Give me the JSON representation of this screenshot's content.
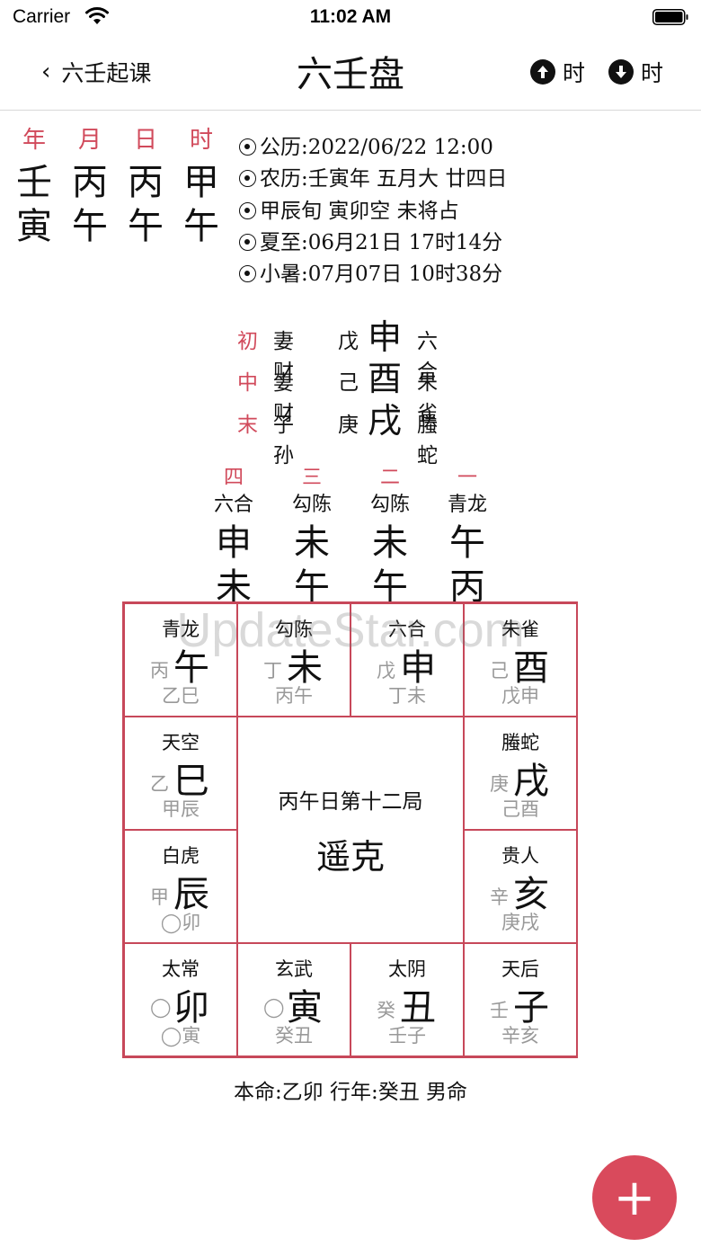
{
  "status": {
    "carrier": "Carrier",
    "time": "11:02 AM"
  },
  "nav": {
    "back_label": "六壬起课",
    "title": "六壬盘",
    "prev_hour": "时",
    "next_hour": "时"
  },
  "pillars": {
    "labels": [
      "年",
      "月",
      "日",
      "时"
    ],
    "stems": [
      "壬",
      "丙",
      "丙",
      "甲"
    ],
    "branches": [
      "寅",
      "午",
      "午",
      "午"
    ]
  },
  "info": [
    "公历:2022/06/22 12:00",
    "农历:壬寅年 五月大 廿四日",
    "甲辰旬 寅卯空 未将占",
    "夏至:06月21日 17时14分",
    "小暑:07月07日 10时38分"
  ],
  "transmissions": [
    {
      "label": "初",
      "relation": "妻财",
      "stem": "戊",
      "branch": "申",
      "god": "六合"
    },
    {
      "label": "中",
      "relation": "妻财",
      "stem": "己",
      "branch": "酉",
      "god": "朱雀"
    },
    {
      "label": "末",
      "relation": "子孙",
      "stem": "庚",
      "branch": "戌",
      "god": "螣蛇"
    }
  ],
  "lessons": [
    {
      "num": "四",
      "god": "六合",
      "top": "申",
      "bottom": "未"
    },
    {
      "num": "三",
      "god": "勾陈",
      "top": "未",
      "bottom": "午"
    },
    {
      "num": "二",
      "god": "勾陈",
      "top": "未",
      "bottom": "午"
    },
    {
      "num": "一",
      "god": "青龙",
      "top": "午",
      "bottom": "丙"
    }
  ],
  "board": {
    "center_title": "丙午日第十二局",
    "center_pattern": "遥克",
    "cells": {
      "r0c0": {
        "god": "青龙",
        "stem": "丙",
        "branch": "午",
        "sub": "乙巳"
      },
      "r0c1": {
        "god": "勾陈",
        "stem": "丁",
        "branch": "未",
        "sub": "丙午"
      },
      "r0c2": {
        "god": "六合",
        "stem": "戊",
        "branch": "申",
        "sub": "丁未"
      },
      "r0c3": {
        "god": "朱雀",
        "stem": "己",
        "branch": "酉",
        "sub": "戊申"
      },
      "r1c0": {
        "god": "天空",
        "stem": "乙",
        "branch": "巳",
        "sub": "甲辰"
      },
      "r1c3": {
        "god": "螣蛇",
        "stem": "庚",
        "branch": "戌",
        "sub": "己酉"
      },
      "r2c0": {
        "god": "白虎",
        "stem": "甲",
        "branch": "辰",
        "sub": "◯卯"
      },
      "r2c3": {
        "god": "贵人",
        "stem": "辛",
        "branch": "亥",
        "sub": "庚戌"
      },
      "r3c0": {
        "god": "太常",
        "stem": "◯",
        "branch": "卯",
        "sub": "◯寅"
      },
      "r3c1": {
        "god": "玄武",
        "stem": "◯",
        "branch": "寅",
        "sub": "癸丑"
      },
      "r3c2": {
        "god": "太阴",
        "stem": "癸",
        "branch": "丑",
        "sub": "壬子"
      },
      "r3c3": {
        "god": "天后",
        "stem": "壬",
        "branch": "子",
        "sub": "辛亥"
      }
    }
  },
  "footer": "本命:乙卯 行年:癸丑 男命",
  "watermark": "UpdateStar.com",
  "fab": {
    "icon": "plus-icon",
    "label": "+"
  },
  "colors": {
    "accent": "#d14a5b",
    "grid": "#c7485a",
    "fab": "#d94a5c",
    "muted": "#999999"
  }
}
